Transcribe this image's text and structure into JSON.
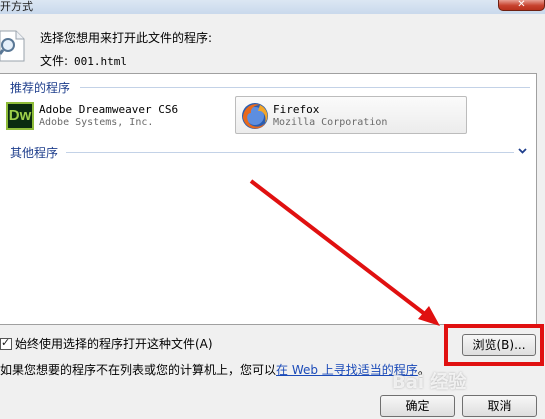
{
  "window": {
    "title": "开方式",
    "close_glyph": "✕"
  },
  "header": {
    "prompt": "选择您想用来打开此文件的程序:",
    "file_label": "文件:",
    "file_name": "001.html"
  },
  "recommended": {
    "label": "推荐的程序",
    "programs": [
      {
        "name": "Adobe Dreamweaver CS6",
        "publisher": "Adobe Systems, Inc.",
        "icon": "dreamweaver-icon",
        "icon_text": "Dw"
      },
      {
        "name": "Firefox",
        "publisher": "Mozilla Corporation",
        "icon": "firefox-icon"
      }
    ]
  },
  "other": {
    "label": "其他程序",
    "expand_icon": "chevron-down-icon"
  },
  "footer": {
    "always_use_label": "始终使用选择的程序打开这种文件(A)",
    "always_use_checked": true,
    "browse_label": "浏览(B)...",
    "hint_prefix": "如果您想要的程序不在列表或您的计算机上，您可以",
    "hint_link": "在 Web 上寻找适当的程序",
    "hint_suffix": "。",
    "ok_label": "确定",
    "cancel_label": "取消"
  },
  "colors": {
    "group_header": "#1e3e8c",
    "link": "#1a4ab8",
    "annotation_red": "#e01010"
  },
  "watermark": "Bai 经验"
}
